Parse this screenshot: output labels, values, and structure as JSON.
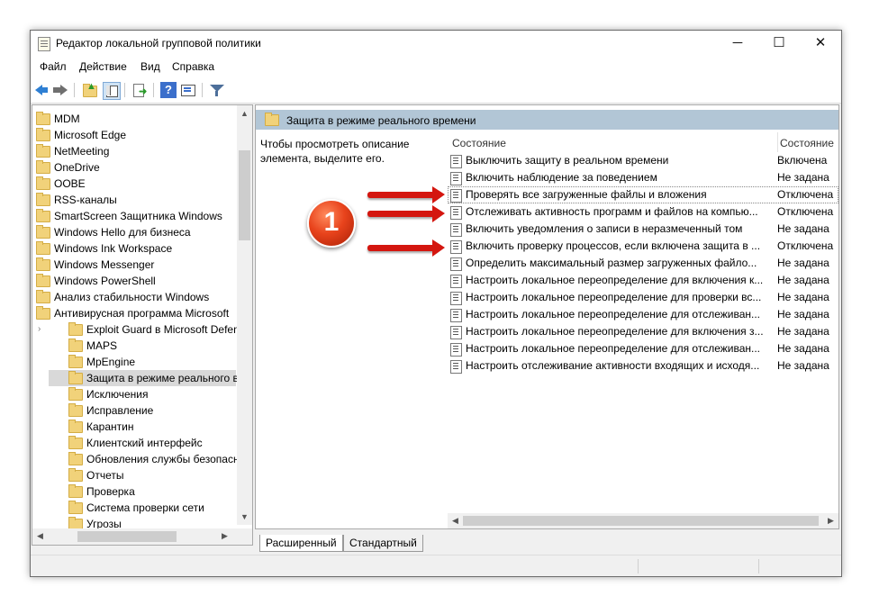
{
  "window": {
    "title": "Редактор локальной групповой политики",
    "controls": {
      "minimize": "─",
      "maximize": "☐",
      "close": "✕"
    }
  },
  "menu": [
    {
      "label": "Файл"
    },
    {
      "label": "Действие"
    },
    {
      "label": "Вид"
    },
    {
      "label": "Справка"
    }
  ],
  "toolbar": {
    "icons": [
      "back-icon",
      "forward-icon",
      "up-folder-icon",
      "show-hide-tree-icon",
      "export-list-icon",
      "help-icon",
      "properties-icon",
      "filter-icon"
    ]
  },
  "tree": {
    "items": [
      {
        "label": "MDM",
        "level": 0
      },
      {
        "label": "Microsoft Edge",
        "level": 0
      },
      {
        "label": "NetMeeting",
        "level": 0
      },
      {
        "label": "OneDrive",
        "level": 0
      },
      {
        "label": "OOBE",
        "level": 0
      },
      {
        "label": "RSS-каналы",
        "level": 0
      },
      {
        "label": "SmartScreen Защитника Windows",
        "level": 0
      },
      {
        "label": "Windows Hello для бизнеса",
        "level": 0
      },
      {
        "label": "Windows Ink Workspace",
        "level": 0
      },
      {
        "label": "Windows Messenger",
        "level": 0
      },
      {
        "label": "Windows PowerShell",
        "level": 0
      },
      {
        "label": "Анализ стабильности Windows",
        "level": 0
      },
      {
        "label": "Антивирусная программа Microsoft",
        "level": 0
      },
      {
        "label": "Exploit Guard в Microsoft Defende",
        "level": 1,
        "expander": "›"
      },
      {
        "label": "MAPS",
        "level": 1
      },
      {
        "label": "MpEngine",
        "level": 1
      },
      {
        "label": "Защита в режиме реального вре",
        "level": 1,
        "selected": true
      },
      {
        "label": "Исключения",
        "level": 1
      },
      {
        "label": "Исправление",
        "level": 1
      },
      {
        "label": "Карантин",
        "level": 1
      },
      {
        "label": "Клиентский интерфейс",
        "level": 1
      },
      {
        "label": "Обновления службы безопаснос",
        "level": 1
      },
      {
        "label": "Отчеты",
        "level": 1
      },
      {
        "label": "Проверка",
        "level": 1
      },
      {
        "label": "Система проверки сети",
        "level": 1
      },
      {
        "label": "Угрозы",
        "level": 1
      }
    ]
  },
  "details": {
    "header": "Защита в режиме реального времени",
    "description": "Чтобы просмотреть описание элемента, выделите его.",
    "col_setting": "Состояние",
    "col_state": "Состояние",
    "rows": [
      {
        "name": "Выключить защиту в реальном времени",
        "state": "Включена"
      },
      {
        "name": "Включить наблюдение за поведением",
        "state": "Не задана"
      },
      {
        "name": "Проверять все загруженные файлы и вложения",
        "state": "Отключена"
      },
      {
        "name": "Отслеживать активность программ и файлов на компью...",
        "state": "Отключена"
      },
      {
        "name": "Включить уведомления о записи в неразмеченный том",
        "state": "Не задана"
      },
      {
        "name": "Включить проверку процессов, если включена защита в ...",
        "state": "Отключена"
      },
      {
        "name": "Определить максимальный размер загруженных файло...",
        "state": "Не задана"
      },
      {
        "name": "Настроить локальное переопределение для включения к...",
        "state": "Не задана"
      },
      {
        "name": "Настроить локальное переопределение для проверки вс...",
        "state": "Не задана"
      },
      {
        "name": "Настроить локальное переопределение для отслеживан...",
        "state": "Не задана"
      },
      {
        "name": "Настроить локальное переопределение для включения з...",
        "state": "Не задана"
      },
      {
        "name": "Настроить локальное переопределение для отслеживан...",
        "state": "Не задана"
      },
      {
        "name": "Настроить отслеживание активности входящих и исходя...",
        "state": "Не задана"
      }
    ]
  },
  "tabs": [
    {
      "label": "Расширенный",
      "active": true
    },
    {
      "label": "Стандартный",
      "active": false
    }
  ],
  "annotation": {
    "badge": "1",
    "color": "#d4160f"
  }
}
